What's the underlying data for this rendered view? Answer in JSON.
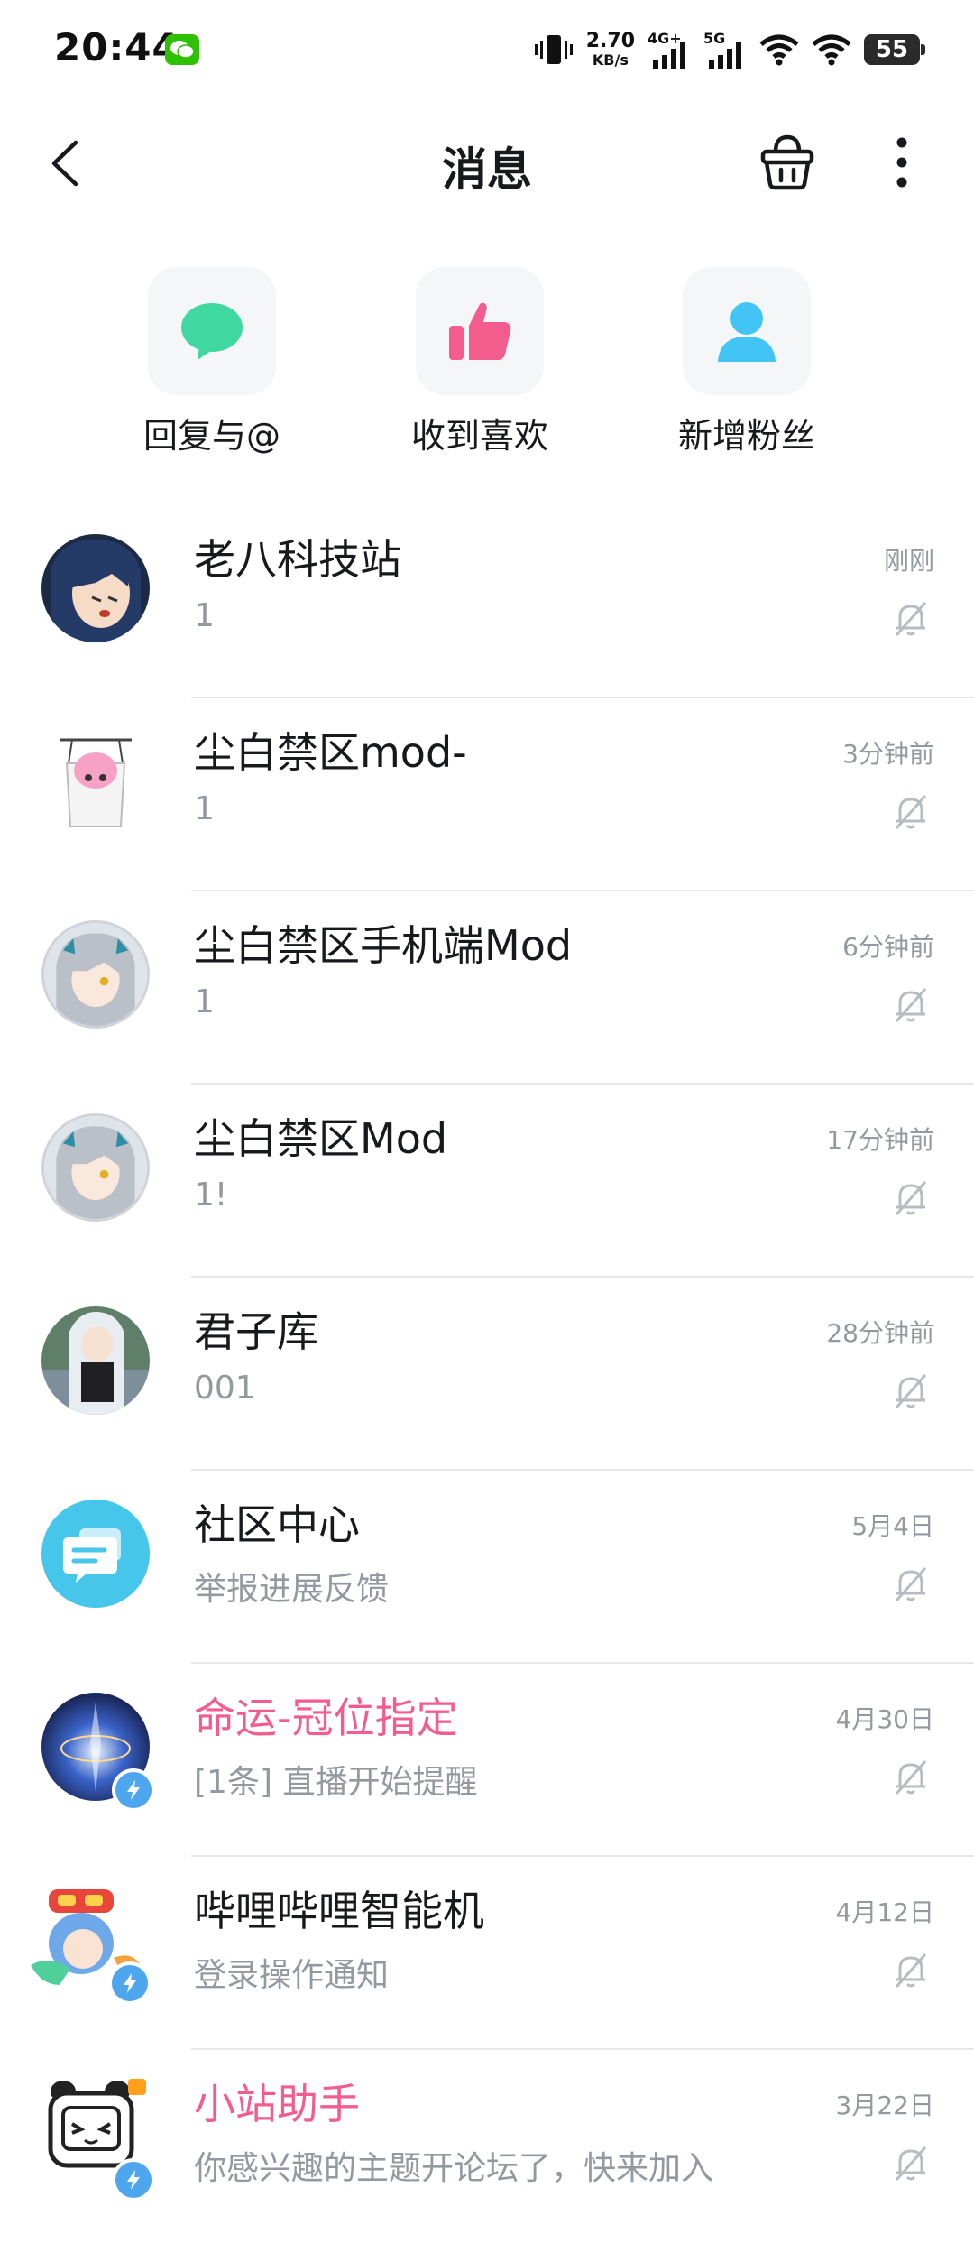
{
  "status_bar": {
    "time": "20:44",
    "net_speed_value": "2.70",
    "net_speed_unit": "KB/s",
    "network_1": "4G+",
    "network_2": "5G",
    "battery": "55"
  },
  "header": {
    "title": "消息"
  },
  "quick_actions": [
    {
      "label": "回复与@",
      "icon": "chat-bubble-icon",
      "color": "#3fd8a0"
    },
    {
      "label": "收到喜欢",
      "icon": "thumbs-up-icon",
      "color": "#f25d8e"
    },
    {
      "label": "新增粉丝",
      "icon": "person-icon",
      "color": "#42c5f5"
    }
  ],
  "conversations": [
    {
      "name": "老八科技站",
      "message": "1",
      "time": "刚刚",
      "name_color": "default"
    },
    {
      "name": "尘白禁区mod-",
      "message": "1",
      "time": "3分钟前",
      "name_color": "default"
    },
    {
      "name": "尘白禁区手机端Mod",
      "message": "1",
      "time": "6分钟前",
      "name_color": "default"
    },
    {
      "name": "尘白禁区Mod",
      "message": "1!",
      "time": "17分钟前",
      "name_color": "default"
    },
    {
      "name": "君子库",
      "message": "001",
      "time": "28分钟前",
      "name_color": "default"
    },
    {
      "name": "社区中心",
      "message": "举报进展反馈",
      "time": "5月4日",
      "name_color": "default"
    },
    {
      "name": "命运-冠位指定",
      "message": "[1条] 直播开始提醒",
      "time": "4月30日",
      "name_color": "pink"
    },
    {
      "name": "哔哩哔哩智能机",
      "message": "登录操作通知",
      "time": "4月12日",
      "name_color": "default"
    },
    {
      "name": "小站助手",
      "message": "你感兴趣的主题开论坛了，快来加入",
      "time": "3月22日",
      "name_color": "pink"
    }
  ],
  "colors": {
    "accent_pink": "#f25d8e",
    "text_primary": "#18191c",
    "text_secondary": "#9499a0",
    "divider": "#e7e7e9"
  }
}
